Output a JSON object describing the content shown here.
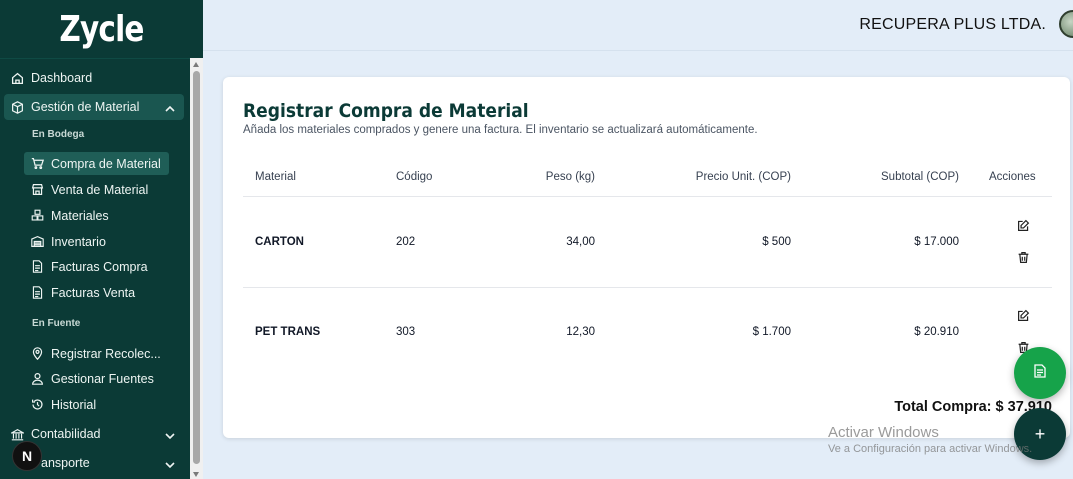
{
  "brand": "Zycle",
  "header": {
    "company": "RECUPERA PLUS LTDA."
  },
  "sidebar": {
    "dashboard": "Dashboard",
    "gestion": "Gestión de Material",
    "section_bodega": "En Bodega",
    "bodega_items": [
      "Compra de Material",
      "Venta de Material",
      "Materiales",
      "Inventario",
      "Facturas Compra",
      "Facturas Venta"
    ],
    "section_fuente": "En Fuente",
    "fuente_items": [
      "Registrar Recolec...",
      "Gestionar Fuentes",
      "Historial"
    ],
    "contabilidad": "Contabilidad",
    "transporte": "ansporte"
  },
  "next_badge": "N",
  "card": {
    "title": "Registrar Compra de Material",
    "subtitle": "Añada los materiales comprados y genere una factura. El inventario se actualizará automáticamente.",
    "columns": [
      "Material",
      "Código",
      "Peso (kg)",
      "Precio Unit. (COP)",
      "Subtotal (COP)",
      "Acciones"
    ],
    "rows": [
      {
        "material": "CARTON",
        "codigo": "202",
        "peso": "34,00",
        "precio": "$ 500",
        "subtotal": "$ 17.000"
      },
      {
        "material": "PET TRANS",
        "codigo": "303",
        "peso": "12,30",
        "precio": "$ 1.700",
        "subtotal": "$ 20.910"
      }
    ],
    "total": "Total Compra: $ 37.910"
  },
  "fab_add": "+",
  "watermark": {
    "line1": "Activar Windows",
    "line2": "Ve a Configuración para activar Windows."
  },
  "colors": {
    "sidebar": "#0b3a36",
    "accent_green": "#16a34a",
    "background": "#e3edf8"
  }
}
